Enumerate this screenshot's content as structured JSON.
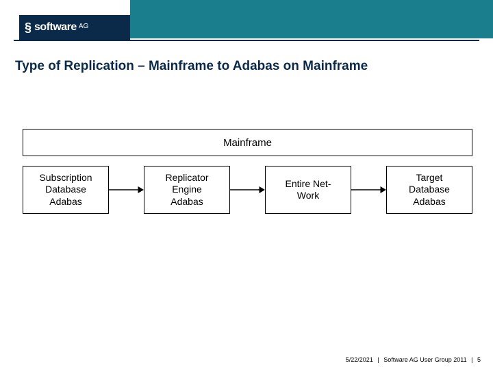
{
  "logo": {
    "brand": "software",
    "suffix": "AG"
  },
  "title": "Type of Replication – Mainframe to Adabas on Mainframe",
  "diagram": {
    "container_label": "Mainframe",
    "nodes": [
      "Subscription\nDatabase\nAdabas",
      "Replicator\nEngine\nAdabas",
      "Entire Net-\nWork",
      "Target\nDatabase\nAdabas"
    ]
  },
  "footer": {
    "date": "5/22/2021",
    "event": "Software AG User Group 2011",
    "page": "5"
  }
}
